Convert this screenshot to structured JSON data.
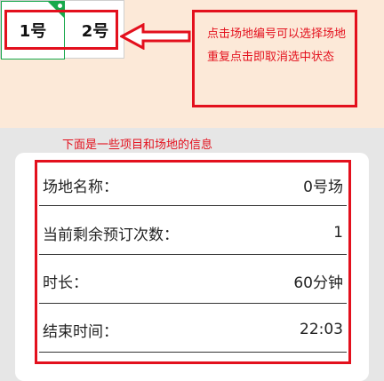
{
  "courts": [
    {
      "label": "1号"
    },
    {
      "label": "2号"
    }
  ],
  "annotation": {
    "note": "点击场地编号可以选择场地重复点击即取消选中状态",
    "caption": "下面是一些项目和场地的信息"
  },
  "info": {
    "rows": [
      {
        "label": "场地名称：",
        "value": "0号场"
      },
      {
        "label": "当前剩余预订次数：",
        "value": "1"
      },
      {
        "label": "时长：",
        "value": "60分钟"
      },
      {
        "label": "结束时间：",
        "value": "22:03"
      }
    ]
  },
  "colors": {
    "annotation_red": "#e3101d",
    "selected_green": "#17a84b",
    "top_background": "#fce9d8",
    "bottom_background": "#e6e6e6"
  }
}
